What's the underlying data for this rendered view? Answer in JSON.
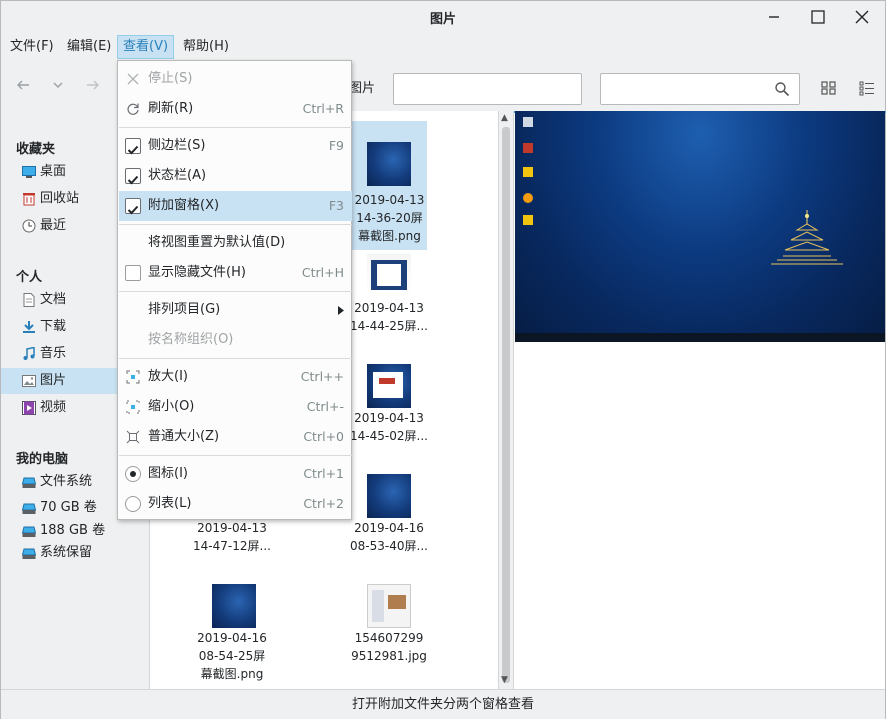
{
  "window": {
    "title": "图片"
  },
  "menubar": {
    "file": "文件(F)",
    "edit": "编辑(E)",
    "view": "查看(V)",
    "help": "帮助(H)"
  },
  "toolbar": {
    "breadcrumb": "图片",
    "location_value": "",
    "search_value": ""
  },
  "sidebar": {
    "favorites_header": "收藏夹",
    "favorites": [
      {
        "label": "桌面",
        "icon": "desktop-icon"
      },
      {
        "label": "回收站",
        "icon": "trash-icon"
      },
      {
        "label": "最近",
        "icon": "recent-icon"
      }
    ],
    "personal_header": "个人",
    "personal": [
      {
        "label": "文档",
        "icon": "document-icon"
      },
      {
        "label": "下载",
        "icon": "download-icon"
      },
      {
        "label": "音乐",
        "icon": "music-icon"
      },
      {
        "label": "图片",
        "icon": "pictures-icon",
        "selected": true
      },
      {
        "label": "视频",
        "icon": "video-icon"
      }
    ],
    "computer_header": "我的电脑",
    "computer": [
      {
        "label": "文件系统",
        "icon": "drive-icon"
      },
      {
        "label": "70 GB 卷",
        "icon": "drive-icon"
      },
      {
        "label": "188 GB 卷",
        "icon": "drive-icon"
      },
      {
        "label": "系统保留",
        "icon": "drive-icon"
      }
    ]
  },
  "files": [
    {
      "line1": "2019-04-13",
      "line2": "14-36-20屏",
      "line3": "幕截图.png",
      "selected": true
    },
    {
      "line1": "2019-04-13",
      "line2": "14-44-25屏...",
      "line3": ""
    },
    {
      "line1": "2019-04-13",
      "line2": "14-45-02屏...",
      "line3": ""
    },
    {
      "line1": "2019-04-13",
      "line2": "14-47-12屏...",
      "line3": ""
    },
    {
      "line1": "2019-04-16",
      "line2": "08-53-40屏...",
      "line3": ""
    },
    {
      "line1": "2019-04-16",
      "line2": "08-54-25屏",
      "line3": "幕截图.png"
    },
    {
      "line1": "154607299",
      "line2": "9512981.jpg",
      "line3": ""
    }
  ],
  "view_menu": {
    "stop": {
      "label": "停止(S)"
    },
    "refresh": {
      "label": "刷新(R)",
      "shortcut": "Ctrl+R"
    },
    "sidebar": {
      "label": "侧边栏(S)",
      "shortcut": "F9",
      "checked": true
    },
    "statusbar": {
      "label": "状态栏(A)",
      "shortcut": "",
      "checked": true
    },
    "extra_pane": {
      "label": "附加窗格(X)",
      "shortcut": "F3",
      "checked": true
    },
    "reset_view": {
      "label": "将视图重置为默认值(D)"
    },
    "show_hidden": {
      "label": "显示隐藏文件(H)",
      "shortcut": "Ctrl+H",
      "checked": false
    },
    "arrange": {
      "label": "排列项目(G)"
    },
    "organize_by_name": {
      "label": "按名称组织(O)"
    },
    "zoom_in": {
      "label": "放大(I)",
      "shortcut": "Ctrl++"
    },
    "zoom_out": {
      "label": "缩小(O)",
      "shortcut": "Ctrl+-"
    },
    "normal_size": {
      "label": "普通大小(Z)",
      "shortcut": "Ctrl+0"
    },
    "icons": {
      "label": "图标(I)",
      "shortcut": "Ctrl+1",
      "selected": true
    },
    "list": {
      "label": "列表(L)",
      "shortcut": "Ctrl+2",
      "selected": false
    }
  },
  "statusbar": {
    "text": "打开附加文件夹分两个窗格查看"
  },
  "colors": {
    "accent": "#3daee9",
    "selection": "#c9e2f3",
    "window_bg": "#eff0f1"
  }
}
